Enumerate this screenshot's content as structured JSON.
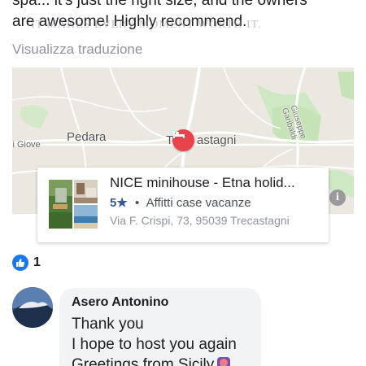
{
  "post": {
    "text_line1": "spa... it's just the right size, and the owners",
    "text_line2": "are awesome! Highly recommend.",
    "watermark": "IT MAKES EVERY MOMENT WORTH IT.",
    "translate_label": "Visualizza traduzione"
  },
  "map": {
    "labels": {
      "pedara": "Pedara",
      "trecastagni_pre": "T",
      "trecastagni_post": "astagni",
      "giove": "li Giove",
      "garibaldi": "Giuseppe Garibaldi"
    },
    "info_symbol": "i"
  },
  "place": {
    "title": "NICE minihouse - Etna holid...",
    "rating": "5★",
    "separator": "•",
    "category": "Affitti case vacanze",
    "address": "Via F. Crispi, 73, 95039 Trecastagni"
  },
  "reactions": {
    "count": "1",
    "icon": "thumbs-up-icon",
    "color": "#1877f2"
  },
  "comment": {
    "author": "Asero Antonino",
    "lines": [
      "Thank you",
      "I hope to host  you again",
      "Greetings from Sicily"
    ]
  }
}
